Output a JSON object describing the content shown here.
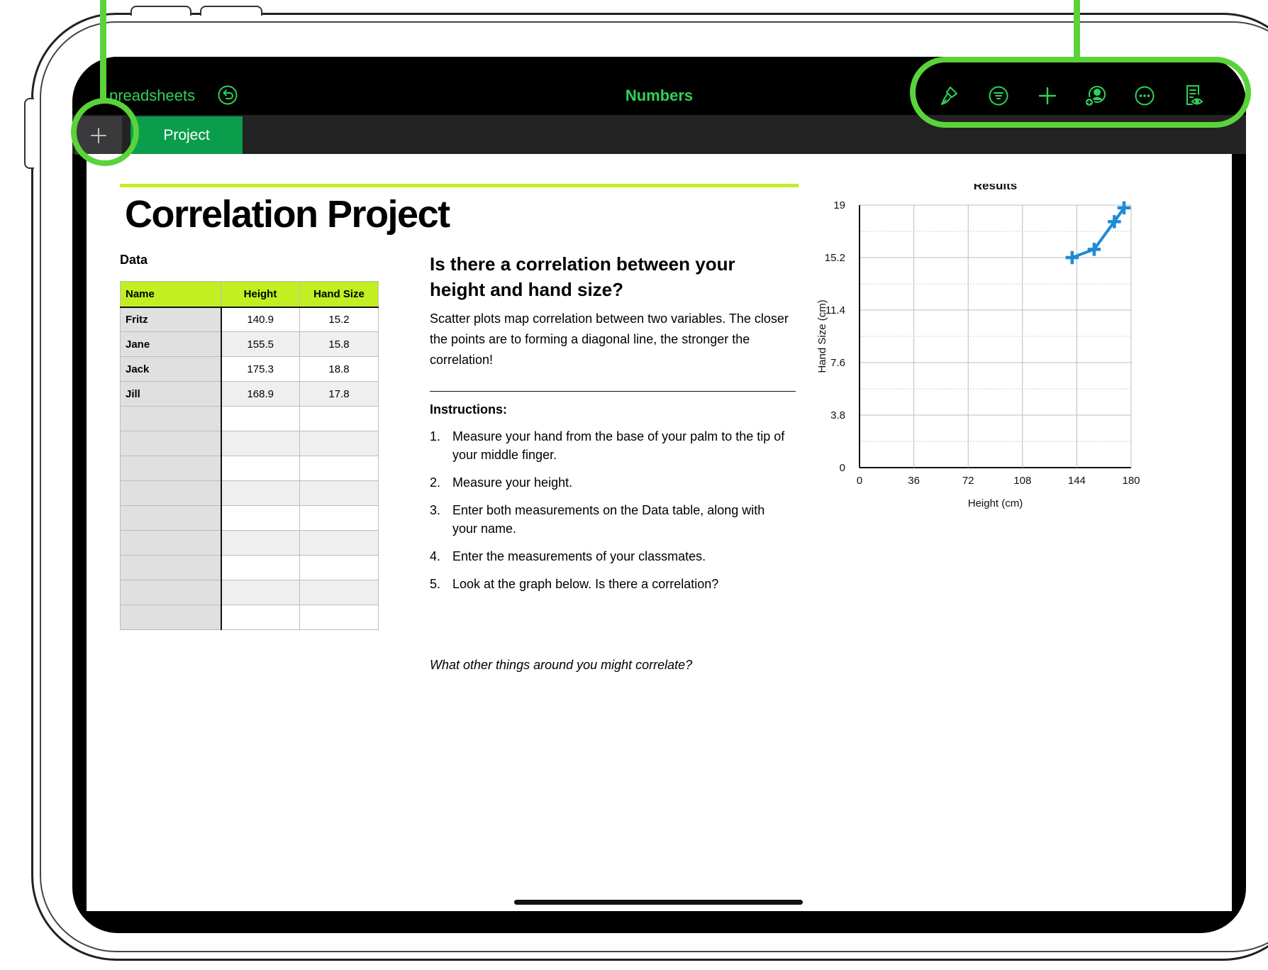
{
  "header": {
    "back_label": "preadsheets",
    "app_title": "Numbers"
  },
  "toolbar": {
    "icons": [
      "paintbrush-icon",
      "filter-icon",
      "plus-icon",
      "collaborate-icon",
      "more-icon",
      "reading-view-icon"
    ]
  },
  "sheets": {
    "tabs": [
      {
        "label": "Project"
      }
    ]
  },
  "document": {
    "title": "Correlation Project",
    "data_label": "Data",
    "table": {
      "headers": [
        "Name",
        "Height",
        "Hand Size"
      ],
      "rows": [
        {
          "name": "Fritz",
          "height": "140.9",
          "hand": "15.2"
        },
        {
          "name": "Jane",
          "height": "155.5",
          "hand": "15.8"
        },
        {
          "name": "Jack",
          "height": "175.3",
          "hand": "18.8"
        },
        {
          "name": "Jill",
          "height": "168.9",
          "hand": "17.8"
        }
      ],
      "empty_rows": 9
    },
    "question": "Is there a correlation between your height and hand size?",
    "description": "Scatter plots map correlation between two variables. The closer the points are to forming a diagonal line, the stronger the correlation!",
    "instructions_heading": "Instructions:",
    "steps": [
      {
        "num": "1.",
        "text": "Measure your hand from the base of your palm to the tip of your middle finger."
      },
      {
        "num": "2.",
        "text": "Measure your height."
      },
      {
        "num": "3.",
        "text": "Enter both measurements on the Data table, along with your name."
      },
      {
        "num": "4.",
        "text": "Enter the measurements of your classmates."
      },
      {
        "num": "5.",
        "text": "Look at the graph below. Is there a correlation?"
      }
    ],
    "final_question": "What other things around you might correlate?"
  },
  "chart_data": {
    "type": "scatter",
    "title": "Results",
    "xlabel": "Height (cm)",
    "ylabel": "Hand Size (cm)",
    "xlim": [
      0,
      180
    ],
    "ylim": [
      0,
      19
    ],
    "xticks": [
      "0",
      "36",
      "72",
      "108",
      "144",
      "180"
    ],
    "yticks": [
      "0",
      "3.8",
      "7.6",
      "11.4",
      "15.2",
      "19"
    ],
    "grid": true,
    "points": [
      {
        "x": 140.9,
        "y": 15.2
      },
      {
        "x": 155.5,
        "y": 15.8
      },
      {
        "x": 175.3,
        "y": 18.8
      },
      {
        "x": 168.9,
        "y": 17.8
      }
    ],
    "trendline": true,
    "colors": {
      "series": "#1e8ad6"
    }
  },
  "colors": {
    "accent_green": "#30d158",
    "callout_green": "#5ad33a",
    "header_lime": "#c1ef22",
    "tab_green": "#0a9d4c"
  }
}
